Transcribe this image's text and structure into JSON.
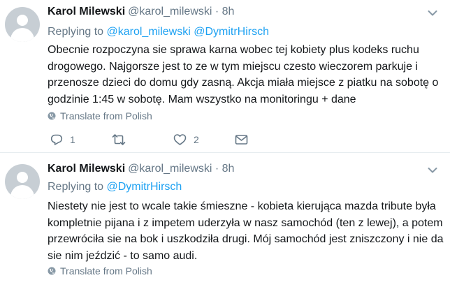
{
  "tweets": [
    {
      "name": "Karol Milewski",
      "handle": "@karol_milewski",
      "dot": "·",
      "time": "8h",
      "replying_prefix": "Replying to ",
      "mentions": [
        "@karol_milewski",
        "@DymitrHirsch"
      ],
      "text": "Obecnie rozpoczyna sie sprawa karna wobec tej kobiety plus kodeks ruchu drogowego. Najgorsze jest to ze w tym miejscu czesto wieczorem parkuje i przenosze dzieci do domu gdy zasną. Akcja miała miejsce z piatku na sobotę o godzinie 1:45 w sobotę. Mam wszystko na monitoringu + dane",
      "translate": "Translate from Polish",
      "reply_count": "1",
      "like_count": "2"
    },
    {
      "name": "Karol Milewski",
      "handle": "@karol_milewski",
      "dot": "·",
      "time": "8h",
      "replying_prefix": "Replying to ",
      "mentions": [
        "@DymitrHirsch"
      ],
      "text": "Niestety nie jest to wcale takie śmieszne - kobieta kierująca mazda tribute była kompletnie pijana i z impetem uderzyła w nasz samochód (ten z lewej), a potem przewróciła sie na bok i uszkodziła drugi. Mój samochód jest zniszczony i nie da sie nim jeździć - to samo audi.",
      "translate": "Translate from Polish"
    }
  ],
  "colors": {
    "accent": "#1da1f2",
    "secondary_text": "#657786",
    "text": "#14171a",
    "divider": "#e6ecf0",
    "avatar_bg": "#c7ced4"
  },
  "icons": [
    "globe-icon",
    "reply-icon",
    "retweet-icon",
    "like-icon",
    "direct-message-icon",
    "chevron-down-icon"
  ]
}
